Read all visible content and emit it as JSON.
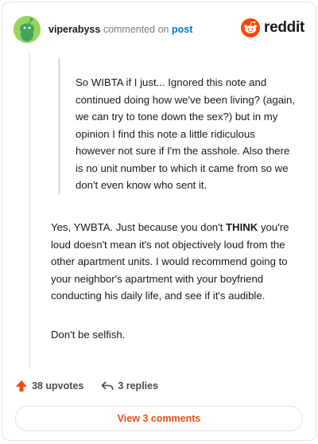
{
  "header": {
    "username": "viperabyss",
    "action_text": "commented on",
    "post_link": "post",
    "brand": "reddit",
    "brand_color": "#ff4500"
  },
  "quote": {
    "text": "So WIBTA if I just... Ignored this note and continued doing how we've been living? (again, we can try to tone down the sex?) but in my opinion I find this note a little ridiculous however not sure if I'm the asshole. Also there is no unit number to which it came from so we don't even know who sent it."
  },
  "comment": {
    "p1_before": "Yes, YWBTA. Just because you don't ",
    "p1_bold": "THINK",
    "p1_after": " you're loud doesn't mean it's not objectively loud from the other apartment units. I would recommend going to your neighbor's apartment with your boyfriend conducting his daily life, and see if it's audible.",
    "p2": "Don't be selfish."
  },
  "footer": {
    "upvotes": "38 upvotes",
    "replies": "3 replies",
    "view_comments": "View 3 comments",
    "upvote_icon": "upvote-arrow-icon",
    "reply_icon": "reply-arrow-icon",
    "accent_color": "#ea4f14"
  }
}
